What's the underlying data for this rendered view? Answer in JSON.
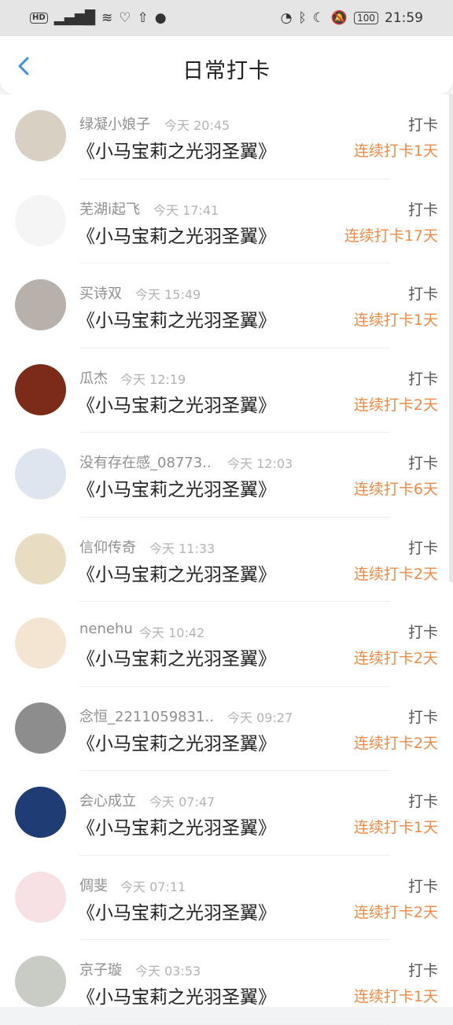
{
  "status_bar": {
    "left_icons": [
      "HD",
      "5G signal",
      "wifi",
      "heart",
      "upload",
      "notification"
    ],
    "time": "21:59",
    "battery": "100"
  },
  "header": {
    "title": "日常打卡",
    "back_icon": "chevron-left-icon"
  },
  "checkins": [
    {
      "name": "绿凝小娘子",
      "time": "今天 20:45",
      "book": "《小马宝莉之光羽圣翼》",
      "action": "打卡",
      "streak": "连续打卡1天",
      "avatar_color": "#d9d0c4"
    },
    {
      "name": "芜湖i起飞",
      "time": "今天 17:41",
      "book": "《小马宝莉之光羽圣翼》",
      "action": "打卡",
      "streak": "连续打卡17天",
      "avatar_color": "#f5f5f5"
    },
    {
      "name": "买诗双",
      "time": "今天 15:49",
      "book": "《小马宝莉之光羽圣翼》",
      "action": "打卡",
      "streak": "连续打卡1天",
      "avatar_color": "#b8b0aa"
    },
    {
      "name": "瓜杰",
      "time": "今天 12:19",
      "book": "《小马宝莉之光羽圣翼》",
      "action": "打卡",
      "streak": "连续打卡2天",
      "avatar_color": "#7b2b18"
    },
    {
      "name": "没有存在感_08773...",
      "time": "今天 12:03",
      "book": "《小马宝莉之光羽圣翼》",
      "action": "打卡",
      "streak": "连续打卡6天",
      "avatar_color": "#dfe5ee"
    },
    {
      "name": "信仰传奇",
      "time": "今天 11:33",
      "book": "《小马宝莉之光羽圣翼》",
      "action": "打卡",
      "streak": "连续打卡2天",
      "avatar_color": "#e8dcc3"
    },
    {
      "name": "nenehu",
      "time": "今天 10:42",
      "book": "《小马宝莉之光羽圣翼》",
      "action": "打卡",
      "streak": "连续打卡2天",
      "avatar_color": "#f3e5d2"
    },
    {
      "name": "念恒_2211059831...",
      "time": "今天 09:27",
      "book": "《小马宝莉之光羽圣翼》",
      "action": "打卡",
      "streak": "连续打卡2天",
      "avatar_color": "#8d8d8d"
    },
    {
      "name": "会心成立",
      "time": "今天 07:47",
      "book": "《小马宝莉之光羽圣翼》",
      "action": "打卡",
      "streak": "连续打卡1天",
      "avatar_color": "#1f3c74"
    },
    {
      "name": "倜斐",
      "time": "今天 07:11",
      "book": "《小马宝莉之光羽圣翼》",
      "action": "打卡",
      "streak": "连续打卡2天",
      "avatar_color": "#f7e1e5"
    },
    {
      "name": "京子璇",
      "time": "今天 03:53",
      "book": "《小马宝莉之光羽圣翼》",
      "action": "打卡",
      "streak": "连续打卡1天",
      "avatar_color": "#c9cbc5"
    }
  ]
}
